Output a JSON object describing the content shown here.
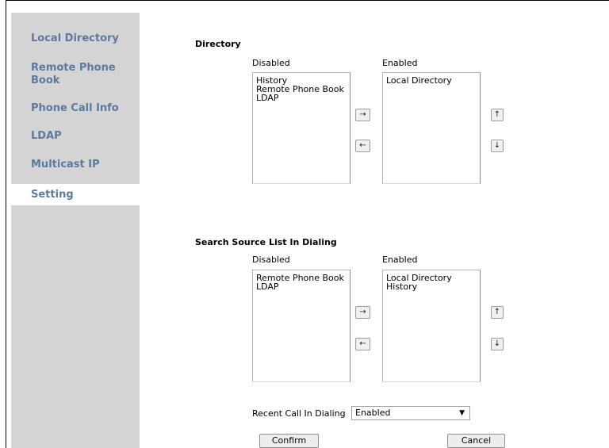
{
  "sidebar": {
    "items": [
      {
        "label": "Local Directory"
      },
      {
        "label": "Remote Phone Book"
      },
      {
        "label": "Phone Call Info"
      },
      {
        "label": "LDAP"
      },
      {
        "label": "Multicast IP"
      },
      {
        "label": "Setting"
      }
    ],
    "active": "Setting"
  },
  "directory": {
    "title": "Directory",
    "disabled_label": "Disabled",
    "enabled_label": "Enabled",
    "disabled_items": [
      "History",
      "Remote Phone Book",
      "LDAP"
    ],
    "enabled_items": [
      "Local Directory"
    ]
  },
  "search_source": {
    "title": "Search Source List In Dialing",
    "disabled_label": "Disabled",
    "enabled_label": "Enabled",
    "disabled_items": [
      "Remote Phone Book",
      "LDAP"
    ],
    "enabled_items": [
      "Local Directory",
      "History"
    ]
  },
  "icons": {
    "move_right": "→",
    "move_left": "←",
    "move_up": "↑",
    "move_down": "↓",
    "dropdown": "▼"
  },
  "recent_call": {
    "label": "Recent Call In Dialing",
    "value": "Enabled"
  },
  "buttons": {
    "confirm": "Confirm",
    "cancel": "Cancel"
  }
}
